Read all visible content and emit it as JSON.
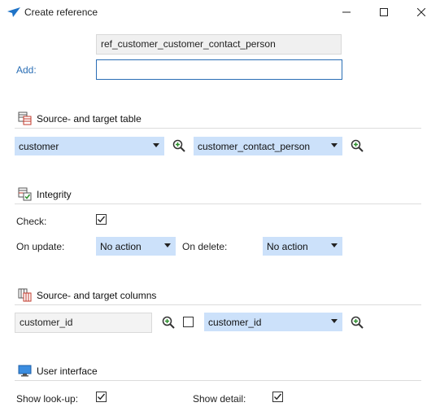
{
  "window": {
    "title": "Create reference",
    "controls": {
      "minimize": "minimize-icon",
      "maximize": "maximize-icon",
      "close": "close-icon"
    }
  },
  "name_field": {
    "value": "ref_customer_customer_contact_person"
  },
  "add": {
    "label": "Add:",
    "value": ""
  },
  "sections": {
    "tables": {
      "title": "Source- and target table",
      "icon": "table-icon"
    },
    "integrity": {
      "title": "Integrity",
      "icon": "integrity-icon"
    },
    "columns": {
      "title": "Source- and target columns",
      "icon": "columns-icon"
    },
    "ui": {
      "title": "User interface",
      "icon": "monitor-icon"
    }
  },
  "tables": {
    "source": "customer",
    "target": "customer_contact_person"
  },
  "integrity": {
    "check_label": "Check:",
    "check_checked": true,
    "on_update_label": "On update:",
    "on_update_value": "No action",
    "on_delete_label": "On delete:",
    "on_delete_value": "No action"
  },
  "columns": {
    "source": "customer_id",
    "include_checked": false,
    "target": "customer_id"
  },
  "ui": {
    "show_lookup_label": "Show look-up:",
    "show_lookup_checked": true,
    "show_detail_label": "Show detail:",
    "show_detail_checked": true
  },
  "colors": {
    "accent": "#2a6eb5",
    "combo_bg": "#cce1fa",
    "readonly_bg": "#f0f0f0"
  }
}
